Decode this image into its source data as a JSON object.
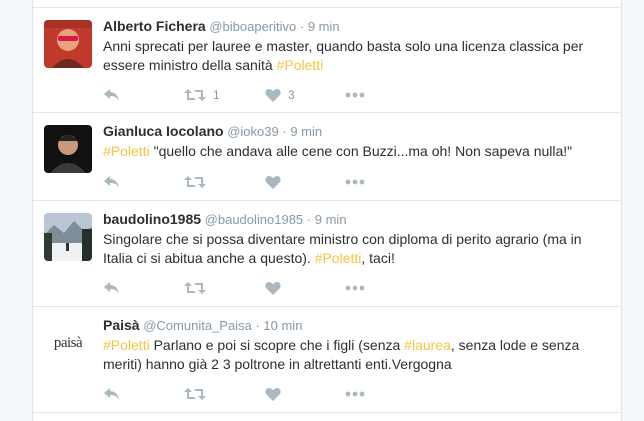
{
  "tweets": [
    {
      "fullname": "Alberto Fichera",
      "handle": "@biboaperitivo",
      "time": "9 min",
      "text_parts": [
        "Anni sprecati per lauree e master, quando basta solo una licenza classica per essere ministro della sanità ",
        "#Poletti",
        ""
      ],
      "retweets": "1",
      "likes": "3"
    },
    {
      "fullname": "Gianluca Iocolano",
      "handle": "@ioko39",
      "time": "9 min",
      "text_parts": [
        "",
        "#Poletti",
        " \"quello che andava alle cene con Buzzi...ma oh! Non sapeva nulla!\""
      ],
      "retweets": "",
      "likes": ""
    },
    {
      "fullname": "baudolino1985",
      "handle": "@baudolino1985",
      "time": "9 min",
      "text_parts": [
        "Singolare che si possa diventare ministro con diploma di perito agrario (ma in Italia ci si abitua anche a questo). ",
        "#Poletti",
        ", taci!"
      ],
      "retweets": "",
      "likes": ""
    },
    {
      "fullname": "Paisà",
      "handle": "@Comunita_Paisa",
      "time": "10 min",
      "text_parts": [
        "",
        "#Poletti",
        " Parlano e poi si scopre che i figli (senza "
      ],
      "text_tag2": "#laurea",
      "text_tail": ", senza lode e senza meriti) hanno già  2 3 poltrone in altrettanti enti.Vergogna",
      "avatar_logo": "paisà",
      "retweets": "",
      "likes": ""
    }
  ],
  "separator": "·",
  "icons": [
    "reply-icon",
    "retweet-icon",
    "like-icon",
    "more-icon"
  ],
  "colors": {
    "hashtag": "#f5c542",
    "meta": "#8899a6",
    "icon": "#aab8c2"
  }
}
